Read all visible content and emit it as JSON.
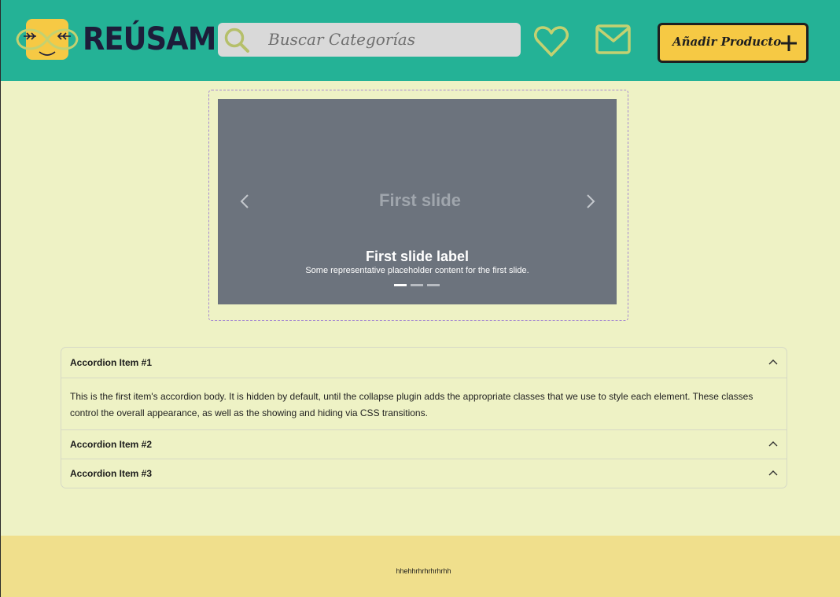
{
  "header": {
    "brand": "REÚSAME",
    "search_placeholder": "Buscar Categorías",
    "add_product_label": "Añadir Producto",
    "colors": {
      "background": "#24b296",
      "button": "#f6c944",
      "icon": "#c3d171"
    }
  },
  "carousel": {
    "slide_title": "First slide",
    "caption_label": "First slide label",
    "caption_text": "Some representative placeholder content for the first slide.",
    "indicators": 3,
    "active_indicator": 1
  },
  "accordion": {
    "items": [
      {
        "label": "Accordion Item #1",
        "body": "This is the first item's accordion body. It is hidden by default, until the collapse plugin adds the appropriate classes that we use to style each element. These classes control the overall appearance, as well as the showing and hiding via CSS transitions."
      },
      {
        "label": "Accordion Item #2"
      },
      {
        "label": "Accordion Item #3"
      }
    ]
  },
  "footer": {
    "text": "hhehhrhrhrhrhrhh"
  }
}
